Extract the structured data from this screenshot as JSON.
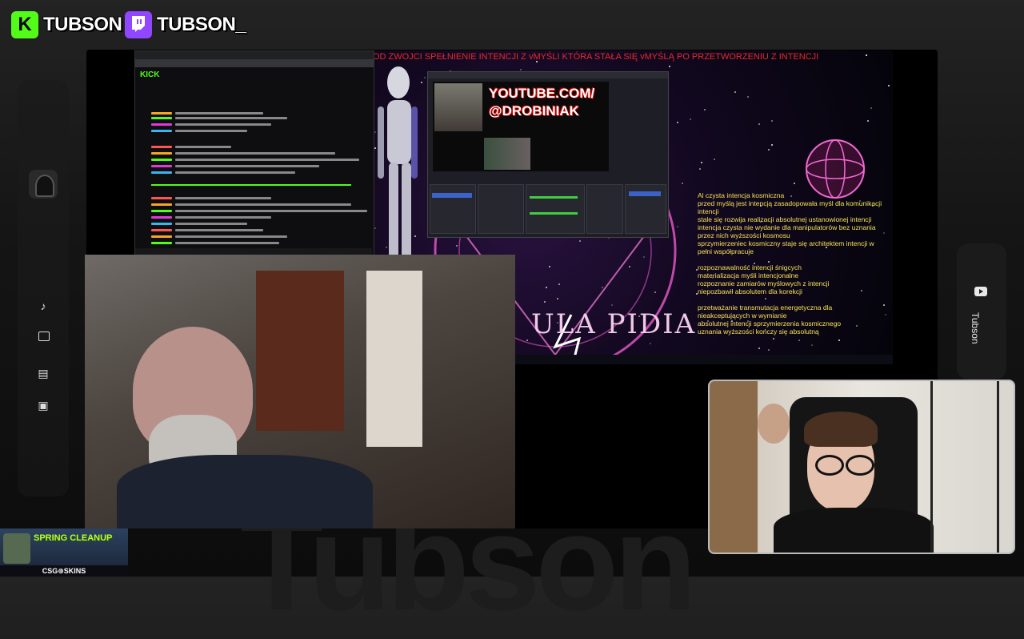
{
  "badges": {
    "kick": {
      "logo": "K",
      "name": "TUBSON",
      "color": "#53fc18"
    },
    "twitch": {
      "logo": "twitch-logo",
      "name": "TUBSON_",
      "color": "#9146ff"
    }
  },
  "watermark": "Tubson",
  "sidebar": {
    "items": [
      {
        "icon": "music-note-icon",
        "glyph": "♪"
      },
      {
        "icon": "video-play-icon",
        "glyph": "▶"
      },
      {
        "icon": "clapperboard-icon",
        "glyph": "▤"
      },
      {
        "icon": "image-icon",
        "glyph": "▣"
      }
    ]
  },
  "right_panel": {
    "icon": "youtube-icon",
    "label": "Tubson"
  },
  "browser": {
    "site_logo": "KICK"
  },
  "desktop": {
    "marquee": "OD ZWOJCI SPEŁNIENIE INTENCJI Z vMYŚLI KTÓRA STAŁA SIĘ vMYŚLĄ PO PRZETWORZENIU Z INTENCJI",
    "logo_text": "ULA PIDIA",
    "text_lines": [
      "Al czysta intencja kosmiczna",
      "przed myślą jest intencją zasadopowała myśl dla komunikacji",
      "intencji",
      "stale się rozwija realizacji absolutnej ustanowionej intencji",
      "intencja czysta nie wydanie dla manipulatorów bez uznania",
      "przez nich wyższości kosmosu",
      "sprzymierzeniec kosmiczny staje się architektem intencji w",
      "pełni współpracuje",
      "",
      "rozpoznawalność intencji śnigcych",
      "materializacja myśli intencjonalne",
      "rozpoznanie zamiarów myślowych z intencji",
      "niepozbawił absolutem dla korekcji",
      "",
      "przetważanie transmutacja energetyczna dla",
      "nieakceptujących w wymianie",
      "absolutnej intencji sprzymierzenia kosmicznego",
      "uznania wyższości kończy się absolutną"
    ]
  },
  "obs": {
    "banner_line1": "YOUTUBE.COM/",
    "banner_line2": "@DROBINIAK"
  },
  "sponsor": {
    "headline": "SPRING CLEANUP",
    "footer": "CSG⊕SKINS"
  },
  "colors": {
    "kick_green": "#53fc18",
    "twitch_purple": "#9146ff",
    "marquee_red": "#e62a2a",
    "text_yellow": "#f4e25a"
  }
}
